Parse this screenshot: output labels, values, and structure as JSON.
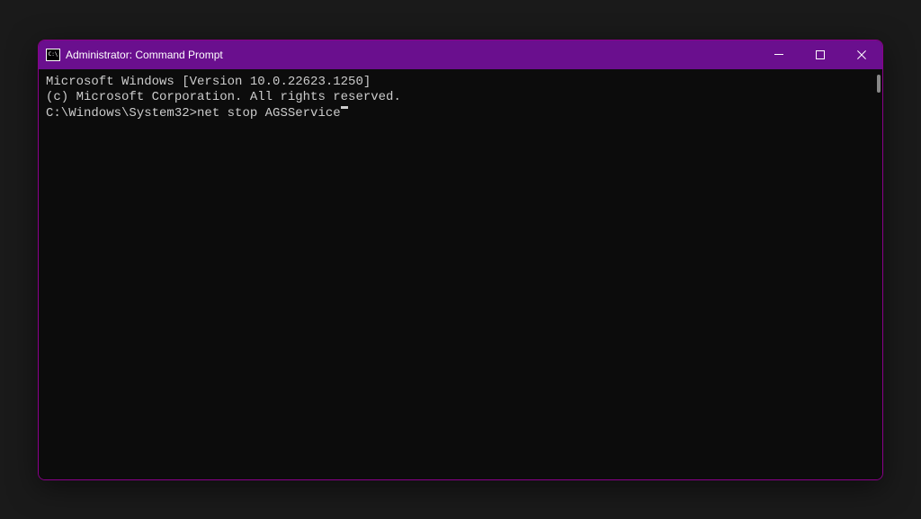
{
  "window": {
    "title": "Administrator: Command Prompt"
  },
  "terminal": {
    "line1": "Microsoft Windows [Version 10.0.22623.1250]",
    "line2": "(c) Microsoft Corporation. All rights reserved.",
    "blank": "",
    "prompt": "C:\\Windows\\System32>",
    "command": "net stop AGSService"
  }
}
